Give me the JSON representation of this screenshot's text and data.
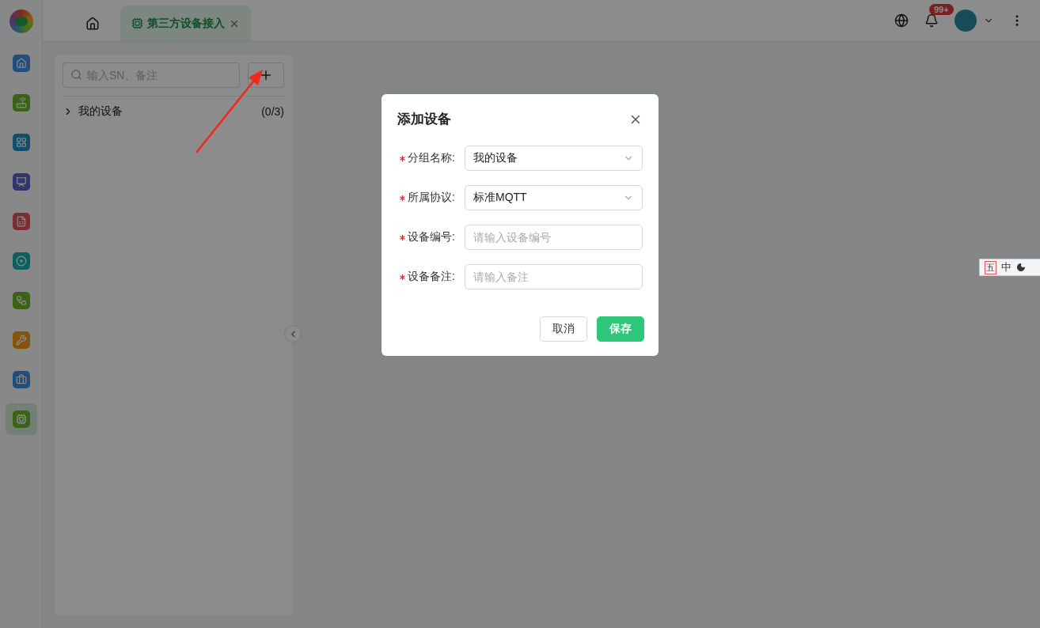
{
  "sidebar": {
    "items": [
      {
        "kind": "home",
        "selected": false
      },
      {
        "kind": "router",
        "selected": false
      },
      {
        "kind": "grid",
        "selected": false
      },
      {
        "kind": "chart",
        "selected": false
      },
      {
        "kind": "report",
        "selected": false
      },
      {
        "kind": "disk",
        "selected": false
      },
      {
        "kind": "flow",
        "selected": false
      },
      {
        "kind": "tools",
        "selected": false
      },
      {
        "kind": "case",
        "selected": false
      },
      {
        "kind": "chip",
        "selected": true
      }
    ]
  },
  "tabs": [
    {
      "kind": "home",
      "selected": false
    },
    {
      "kind": "page",
      "label": "第三方设备接入",
      "selected": true
    }
  ],
  "header": {
    "notification_badge": "99+"
  },
  "device_panel": {
    "search": {
      "placeholder": "输入SN、备注"
    },
    "groups": [
      {
        "label": "我的设备",
        "count": "(0/3)",
        "expanded": false
      }
    ]
  },
  "dialog": {
    "title": "添加设备",
    "fields": [
      {
        "kind": "select",
        "label": "分组名称:",
        "required": true,
        "value": "我的设备"
      },
      {
        "kind": "select",
        "label": "所属协议:",
        "required": true,
        "value": "标准MQTT"
      },
      {
        "kind": "input",
        "label": "设备编号:",
        "required": true,
        "placeholder": "请输入设备编号"
      },
      {
        "kind": "input",
        "label": "设备备注:",
        "required": true,
        "placeholder": "请输入备注"
      }
    ],
    "buttons": [
      {
        "kind": "default",
        "label": "取消"
      },
      {
        "kind": "primary",
        "label": "保存"
      }
    ]
  },
  "ime_toolbar": {
    "items": [
      "五",
      "中"
    ]
  }
}
